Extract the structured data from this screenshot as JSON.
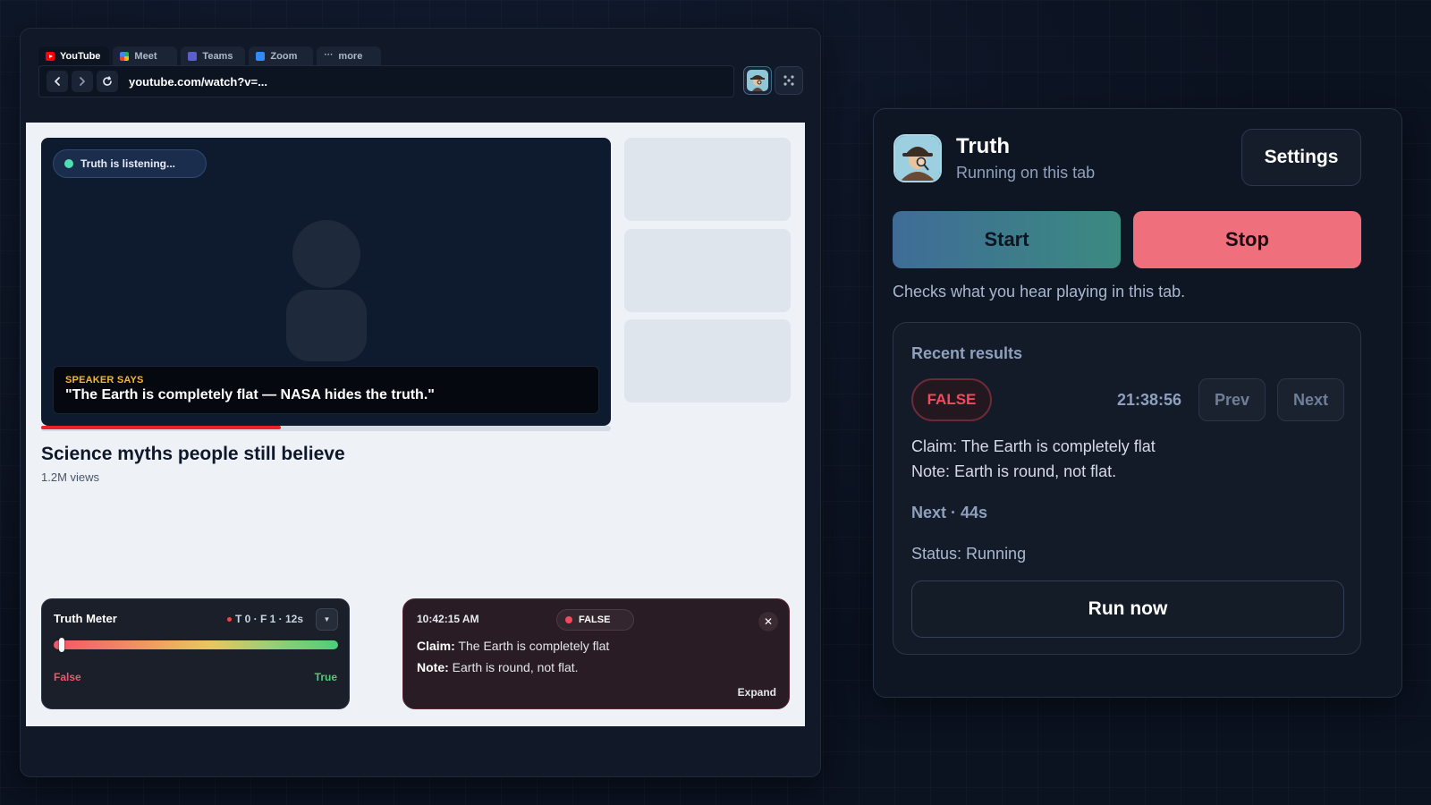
{
  "browser": {
    "tabs": [
      {
        "label": "YouTube",
        "icon": "youtube-icon",
        "active": true
      },
      {
        "label": "Meet",
        "icon": "meet-icon",
        "active": false
      },
      {
        "label": "Teams",
        "icon": "teams-icon",
        "active": false
      },
      {
        "label": "Zoom",
        "icon": "zoom-icon",
        "active": false
      },
      {
        "label": "more",
        "icon": "more-icon",
        "prefix": "···",
        "active": false
      }
    ],
    "url": "youtube.com/watch?v=..."
  },
  "video": {
    "listening_label": "Truth is listening...",
    "caption_label": "SPEAKER SAYS",
    "caption_text": "\"The Earth is completely flat — NASA hides the truth.\"",
    "progress_fraction": 0.42,
    "title": "Science myths people still believe",
    "views": "1.2M views"
  },
  "truth_meter": {
    "title": "Truth Meter",
    "stats": "T 0 · F 1 · 12s",
    "false_label": "False",
    "true_label": "True",
    "level_fraction": 0.02
  },
  "fact_card": {
    "time": "10:42:15 AM",
    "verdict": "FALSE",
    "claim_label": "Claim:",
    "claim_text": " The Earth is completely flat",
    "note_label": "Note:",
    "note_text": " Earth is round, not flat.",
    "expand_label": "Expand",
    "close_glyph": "✕"
  },
  "panel": {
    "name": "Truth",
    "subtitle": "Running on this tab",
    "settings_label": "Settings",
    "start_label": "Start",
    "stop_label": "Stop",
    "description": "Checks what you hear playing in this tab.",
    "results": {
      "title": "Recent results",
      "verdict": "FALSE",
      "time": "21:38:56",
      "prev_label": "Prev",
      "next_label": "Next",
      "claim": "Claim: The Earth is completely flat",
      "note": "Note: Earth is round, not flat.",
      "countdown": "Next · 44s",
      "status": "Status: Running",
      "run_now_label": "Run now"
    }
  },
  "colors": {
    "false_red": "#f24a5c",
    "true_green": "#4ccd7c",
    "listening_green": "#4ee0b3",
    "caption_label_yellow": "#f5b731",
    "stop_button": "#ef6f7d"
  }
}
